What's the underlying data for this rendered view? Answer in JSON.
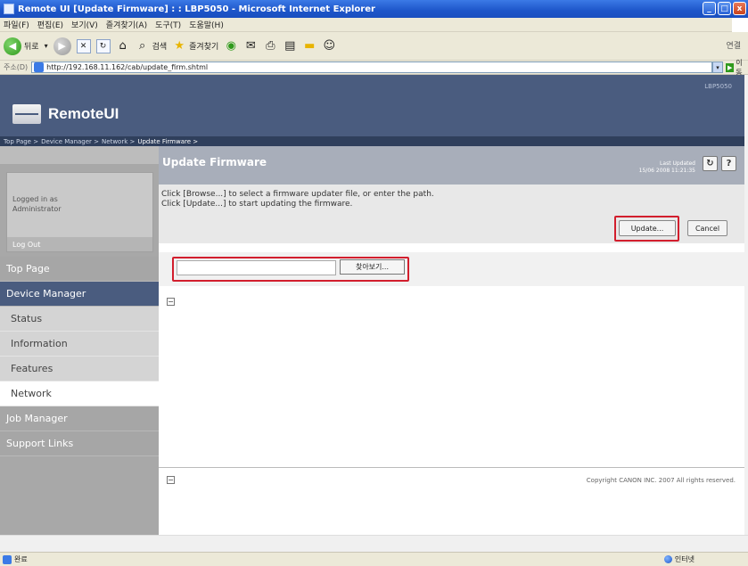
{
  "window": {
    "title": "Remote UI [Update Firmware] : : LBP5050 - Microsoft Internet Explorer",
    "min_label": "_",
    "max_label": "□",
    "close_label": "x"
  },
  "menubar": {
    "items": [
      "파일(F)",
      "편집(E)",
      "보기(V)",
      "즐겨찾기(A)",
      "도구(T)",
      "도움말(H)"
    ]
  },
  "toolbar": {
    "back_label": "뒤로",
    "search_label": "검색",
    "favorites_label": "즐겨찾기",
    "links_label": "연결"
  },
  "addressbar": {
    "label": "주소(D)",
    "url": "http://192.168.11.162/cab/update_firm.shtml",
    "go_label": "이동"
  },
  "header": {
    "logo_text": "RemoteUI",
    "device_name": "LBP5050"
  },
  "breadcrumb": {
    "items": [
      "Top Page >",
      "Device Manager >",
      "Network >",
      "Update Firmware >"
    ]
  },
  "sidebar": {
    "login_line1": "Logged in as",
    "login_line2": "Administrator",
    "logout_label": "Log Out",
    "nav": {
      "top_page": "Top Page",
      "device_manager": "Device Manager",
      "status": "Status",
      "information": "Information",
      "features": "Features",
      "network": "Network",
      "job_manager": "Job Manager",
      "support_links": "Support Links"
    }
  },
  "main": {
    "title": "Update Firmware",
    "last_updated_label": "Last Updated",
    "last_updated_value": "15/06 2008 11:21:35",
    "refresh_icon": "↻",
    "help_label": "?",
    "instruction_1": "Click [Browse...] to select a firmware updater file, or enter the path.",
    "instruction_2": "Click [Update...] to start updating the firmware.",
    "update_label": "Update...",
    "cancel_label": "Cancel",
    "file_value": "",
    "browse_label": "찾아보기...",
    "collapse_icon": "−",
    "copyright": "Copyright CANON INC. 2007 All rights reserved."
  },
  "statusbar": {
    "left_text": "완료",
    "zone_text": "인터넷"
  },
  "colors": {
    "header_bg": "#4a5c7f",
    "highlight_red": "#d21e2d",
    "sidebar_bg": "#a8a8a8"
  }
}
